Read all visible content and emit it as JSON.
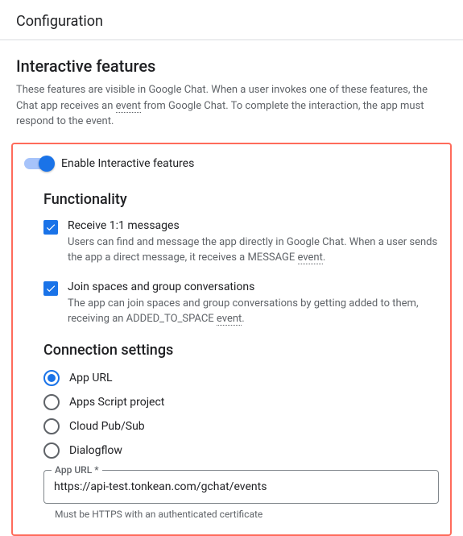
{
  "header": {
    "title": "Configuration"
  },
  "section": {
    "title": "Interactive features",
    "desc_pre": "These features are visible in Google Chat. When a user invokes one of these features, the Chat app receives an ",
    "desc_link": "event",
    "desc_post": " from Google Chat. To complete the interaction, the app must respond to the event."
  },
  "toggle": {
    "label": "Enable Interactive features",
    "on": true
  },
  "functionality": {
    "title": "Functionality",
    "items": [
      {
        "label": "Receive 1:1 messages",
        "desc_pre": "Users can find and message the app directly in Google Chat. When a user sends the app a direct message, it receives a MESSAGE ",
        "desc_link": "event",
        "desc_post": ".",
        "checked": true
      },
      {
        "label": "Join spaces and group conversations",
        "desc_pre": "The app can join spaces and group conversations by getting added to them, receiving an ADDED_TO_SPACE ",
        "desc_link": "event",
        "desc_post": ".",
        "checked": true
      }
    ]
  },
  "connection": {
    "title": "Connection settings",
    "options": [
      {
        "label": "App URL",
        "selected": true
      },
      {
        "label": "Apps Script project",
        "selected": false
      },
      {
        "label": "Cloud Pub/Sub",
        "selected": false
      },
      {
        "label": "Dialogflow",
        "selected": false
      }
    ],
    "input": {
      "label": "App URL *",
      "value": "https://api-test.tonkean.com/gchat/events",
      "helper": "Must be HTTPS with an authenticated certificate"
    }
  }
}
